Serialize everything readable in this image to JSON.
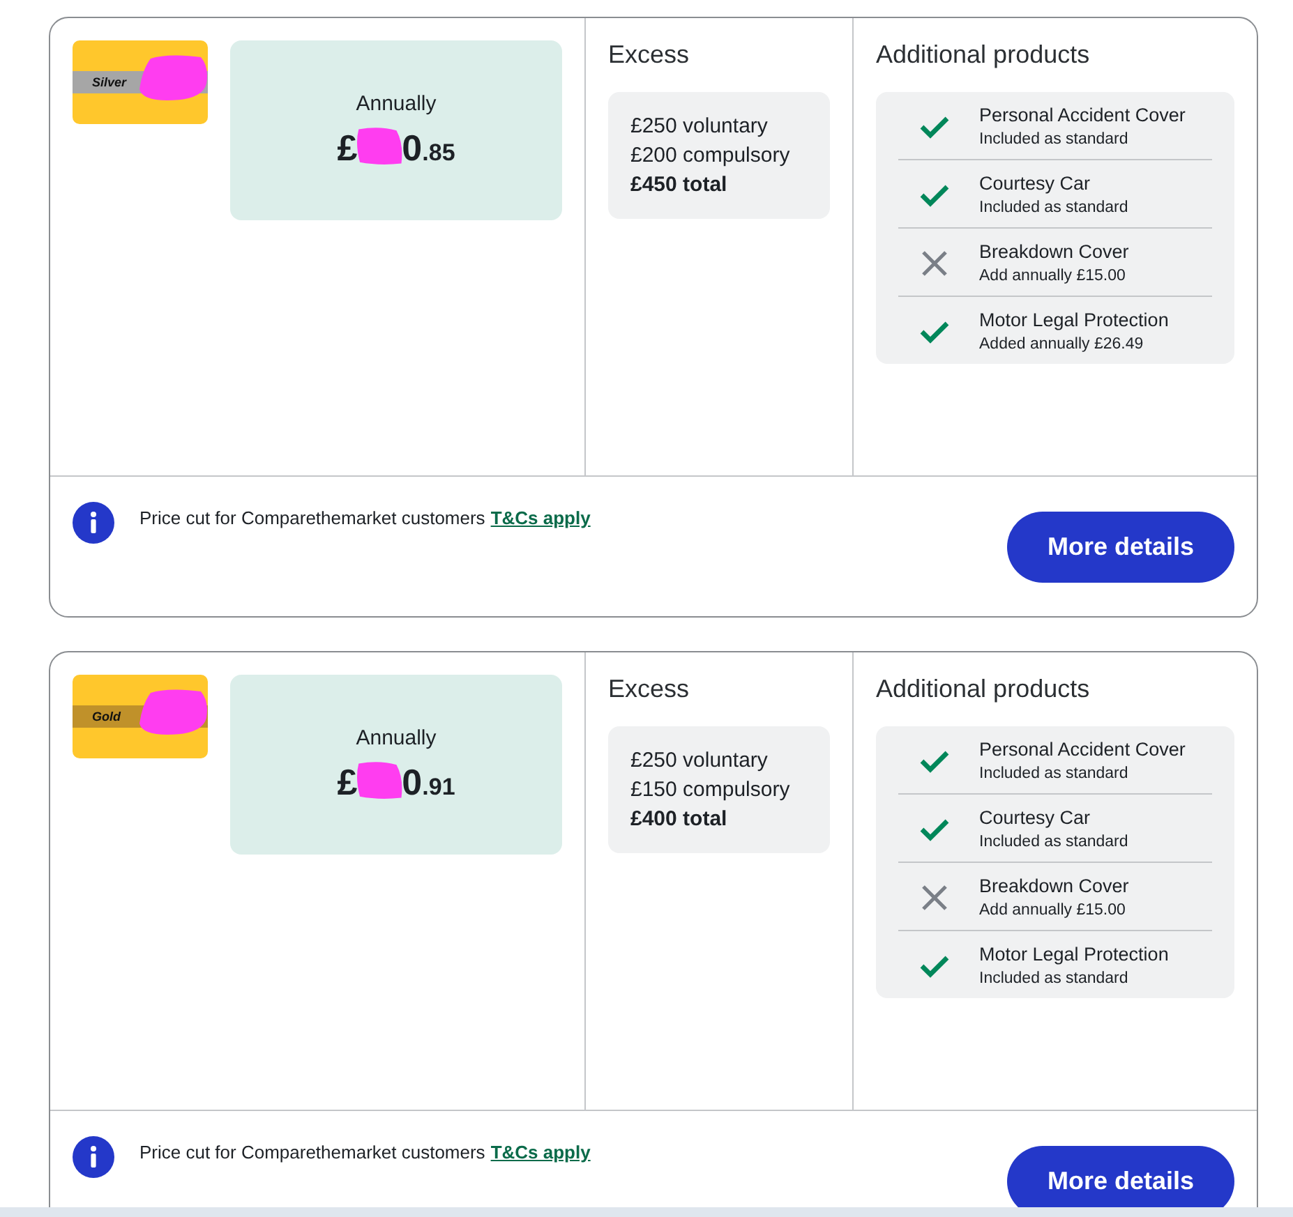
{
  "quotes": [
    {
      "tier": {
        "label": "Silver",
        "color": "#a6a6a6",
        "redacted": true
      },
      "price": {
        "period": "Annually",
        "symbol": "£",
        "redacted": true,
        "pounds_visible": "0",
        "pence": ".85"
      },
      "excess": {
        "heading": "Excess",
        "lines": [
          "£250 voluntary",
          "£200 compulsory"
        ],
        "total": "£450 total"
      },
      "products": {
        "heading": "Additional products",
        "items": [
          {
            "name": "Personal Accident Cover",
            "note": "Included as standard",
            "included": true
          },
          {
            "name": "Courtesy Car",
            "note": "Included as standard",
            "included": true
          },
          {
            "name": "Breakdown Cover",
            "note": "Add annually £15.00",
            "included": false
          },
          {
            "name": "Motor Legal Protection",
            "note": "Added annually £26.49",
            "included": true
          }
        ]
      },
      "footer": {
        "message": "Price cut for Comparethemarket customers",
        "link": "T&Cs apply",
        "button": "More details"
      }
    },
    {
      "tier": {
        "label": "Gold",
        "color": "#c0912a",
        "redacted": true
      },
      "price": {
        "period": "Annually",
        "symbol": "£",
        "redacted": true,
        "pounds_visible": "0",
        "pence": ".91"
      },
      "excess": {
        "heading": "Excess",
        "lines": [
          "£250 voluntary",
          "£150 compulsory"
        ],
        "total": "£400 total"
      },
      "products": {
        "heading": "Additional products",
        "items": [
          {
            "name": "Personal Accident Cover",
            "note": "Included as standard",
            "included": true
          },
          {
            "name": "Courtesy Car",
            "note": "Included as standard",
            "included": true
          },
          {
            "name": "Breakdown Cover",
            "note": "Add annually £15.00",
            "included": false
          },
          {
            "name": "Motor Legal Protection",
            "note": "Included as standard",
            "included": true
          }
        ]
      },
      "footer": {
        "message": "Price cut for Comparethemarket customers",
        "link": "T&Cs apply",
        "button": "More details"
      }
    }
  ]
}
